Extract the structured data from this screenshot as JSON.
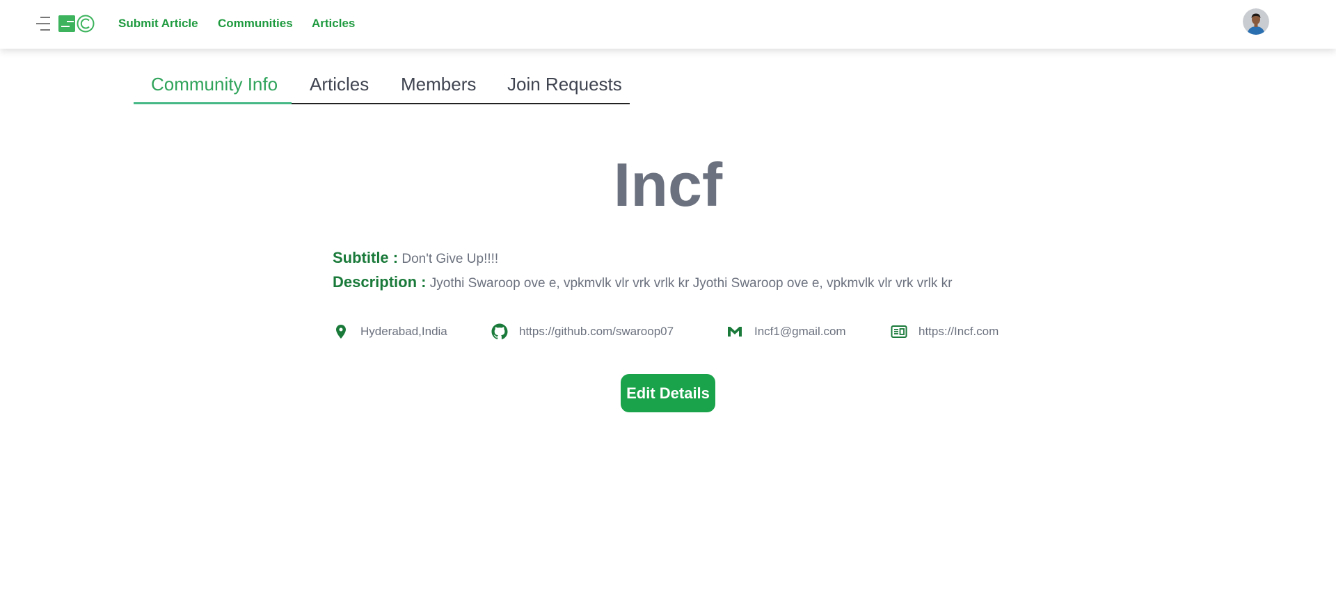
{
  "header": {
    "nav": [
      {
        "label": "Submit Article"
      },
      {
        "label": "Communities"
      },
      {
        "label": "Articles"
      }
    ],
    "menu_icon": "hamburger-icon",
    "logo_icon": "logo-icon",
    "avatar_icon": "user-avatar"
  },
  "tabs": [
    {
      "label": "Community Info",
      "active": true
    },
    {
      "label": "Articles",
      "active": false
    },
    {
      "label": "Members",
      "active": false
    },
    {
      "label": "Join Requests",
      "active": false
    }
  ],
  "community": {
    "name": "Incf",
    "subtitle_label": "Subtitle :",
    "subtitle": "Don't Give Up!!!!",
    "description_label": "Description :",
    "description": "Jyothi Swaroop ove e, vpkmvlk vlr vrk vrlk kr Jyothi Swaroop ove e, vpkmvlk vlr vrk vrlk kr"
  },
  "contacts": [
    {
      "icon": "location-icon",
      "text": "Hyderabad,India"
    },
    {
      "icon": "github-icon",
      "text": "https://github.com/swaroop07"
    },
    {
      "icon": "gmail-icon",
      "text": "Incf1@gmail.com"
    },
    {
      "icon": "website-icon",
      "text": "https://Incf.com"
    }
  ],
  "actions": {
    "edit_label": "Edit Details"
  },
  "colors": {
    "brand_green": "#1e9a3f",
    "button_green": "#1aa34a",
    "label_green": "#1a7a3a",
    "active_tab": "#2fa35a",
    "tab_underline": "#46b886",
    "muted_text": "#6b717e"
  }
}
